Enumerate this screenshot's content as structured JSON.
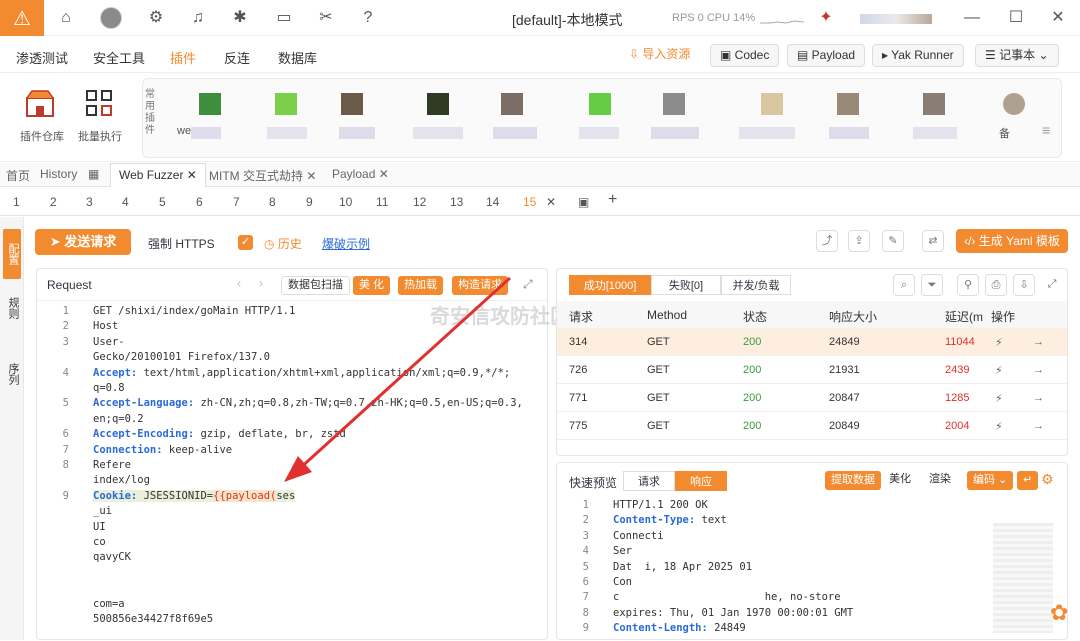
{
  "window": {
    "title": "[default]-本地模式",
    "status": "RPS 0 CPU 14%"
  },
  "menu": {
    "items": [
      "渗透测试",
      "安全工具",
      "插件",
      "反连",
      "数据库"
    ],
    "import": "导入资源",
    "codec": "Codec",
    "payload": "Payload",
    "yakrunner": "Yak Runner",
    "notebook": "记事本"
  },
  "plugins": {
    "store": "插件仓库",
    "batch": "批量执行",
    "common_label": "常用插件",
    "first_label": "we",
    "last_label": "备"
  },
  "tabs": {
    "home": "首页",
    "history": "History",
    "fuzzer": "Web Fuzzer",
    "mitm": "MITM 交互式劫持",
    "payload": "Payload"
  },
  "subtabs": [
    "1",
    "2",
    "3",
    "4",
    "5",
    "6",
    "7",
    "8",
    "9",
    "10",
    "11",
    "12",
    "13",
    "14",
    "15"
  ],
  "sidebar": {
    "tag1": "配置",
    "tag2": "规则",
    "tag3": "序列"
  },
  "actions": {
    "send": "发送请求",
    "https": "强制 HTTPS",
    "history": "历史",
    "example": "爆破示例",
    "gen": "生成 Yaml 模板"
  },
  "request": {
    "title": "Request",
    "scan": "数据包扫描",
    "beautify": "美 化",
    "hotload": "热加载",
    "build": "构造请求",
    "lines": [
      {
        "n": "1",
        "t": "GET /shixi/index/goMain HTTP/1.1"
      },
      {
        "n": "2",
        "t": "Host"
      },
      {
        "n": "3",
        "t": "User-"
      },
      {
        "n": "",
        "t": "Gecko/20100101 Firefox/137.0"
      },
      {
        "n": "4",
        "t": "Accept: text/html,application/xhtml+xml,application/xml;q=0.9,*/*;"
      },
      {
        "n": "",
        "t": "q=0.8"
      },
      {
        "n": "5",
        "t": "Accept-Language: zh-CN,zh;q=0.8,zh-TW;q=0.7,zh-HK;q=0.5,en-US;q=0.3,"
      },
      {
        "n": "",
        "t": "en;q=0.2"
      },
      {
        "n": "6",
        "t": "Accept-Encoding: gzip, deflate, br, zstd"
      },
      {
        "n": "7",
        "t": "Connection: keep-alive"
      },
      {
        "n": "8",
        "t": "Refere"
      },
      {
        "n": "",
        "t": "index/log"
      },
      {
        "n": "9",
        "t": "Cookie: JSESSIONID="
      },
      {
        "n": "",
        "t": "_ui"
      },
      {
        "n": "",
        "t": "UI"
      },
      {
        "n": "",
        "t": "co"
      },
      {
        "n": "",
        "t": "qavyCK"
      },
      {
        "n": "",
        "t": ""
      },
      {
        "n": "",
        "t": ""
      },
      {
        "n": "",
        "t": "com=a"
      },
      {
        "n": "",
        "t": "500856e34427f8f69e5"
      }
    ],
    "payload_token": "{{payload(",
    "payload_tail": "ses"
  },
  "response": {
    "tabs": {
      "success": "成功[1000]",
      "fail": "失败[0]",
      "concurrent": "并发/负载"
    },
    "headers": [
      "请求",
      "Method",
      "状态",
      "响应大小",
      "延迟(m",
      "操作"
    ],
    "rows": [
      {
        "id": "314",
        "method": "GET",
        "status": "200",
        "size": "24849",
        "delay": "11044"
      },
      {
        "id": "726",
        "method": "GET",
        "status": "200",
        "size": "21931",
        "delay": "2439"
      },
      {
        "id": "771",
        "method": "GET",
        "status": "200",
        "size": "20847",
        "delay": "1285"
      },
      {
        "id": "775",
        "method": "GET",
        "status": "200",
        "size": "20849",
        "delay": "2004"
      }
    ]
  },
  "preview": {
    "title": "快速预览",
    "req": "请求",
    "resp": "响应",
    "extract": "提取数据",
    "beautify": "美化",
    "render": "渲染",
    "encode": "编码",
    "lines": [
      {
        "n": "1",
        "t": "HTTP/1.1 200 OK"
      },
      {
        "n": "2",
        "t": "Content-Type: text"
      },
      {
        "n": "3",
        "t": "Connecti"
      },
      {
        "n": "4",
        "t": "Ser"
      },
      {
        "n": "5",
        "t": "Dat  i, 18 Apr 2025 01"
      },
      {
        "n": "6",
        "t": "Con"
      },
      {
        "n": "7",
        "t": "c                       he, no-store"
      },
      {
        "n": "8",
        "t": "expires: Thu, 01 Jan 1970 00:00:01 GMT"
      },
      {
        "n": "9",
        "t": "Content-Length: 24849"
      }
    ]
  },
  "watermark": "奇安信攻防社区"
}
